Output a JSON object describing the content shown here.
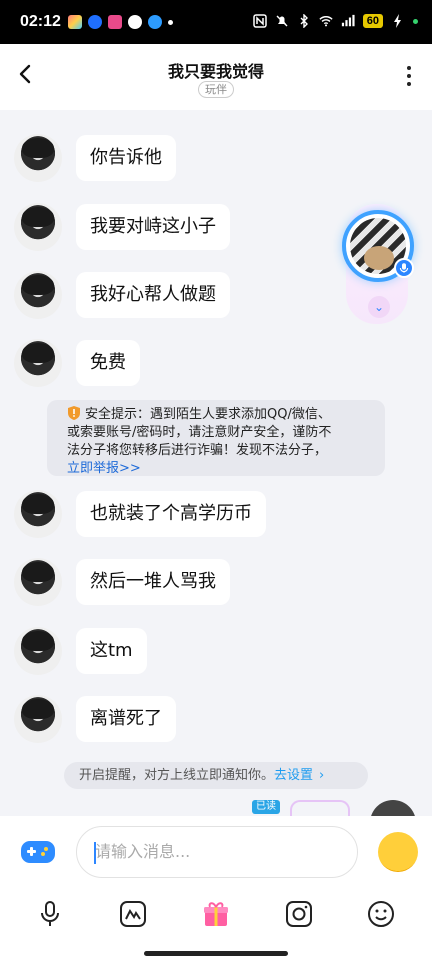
{
  "status_bar": {
    "time": "02:12",
    "battery": "60",
    "network": "5G"
  },
  "header": {
    "title": "我只要我觉得",
    "tag": "玩伴"
  },
  "messages": [
    {
      "text": "你告诉他"
    },
    {
      "text": "我要对峙这小子"
    },
    {
      "text": "我好心帮人做题"
    },
    {
      "text": "免费"
    },
    {
      "text": "也就装了个高学历币"
    },
    {
      "text": "然后一堆人骂我"
    },
    {
      "text": "这tm"
    },
    {
      "text": "离谱死了"
    }
  ],
  "safety_notice": {
    "line1": "安全提示：遇到陌生人要求添加QQ/微信、",
    "line2": "或索要账号/密码时，请注意财产安全，谨防不",
    "line3": "法分子将您转移后进行诈骗！发现不法分子，",
    "link": "立即举报>>"
  },
  "online_reminder": {
    "text": "开启提醒，对方上线立即通知你。",
    "action": "去设置",
    "chevron": "›"
  },
  "read_tag": "已读",
  "input": {
    "placeholder": "请输入消息..."
  },
  "colors": {
    "accent": "#2d86ff",
    "link": "#1e6ad8",
    "chat_bg": "#f3f4f8"
  },
  "icons": [
    "back-arrow-icon",
    "more-vertical-icon",
    "microphone-icon",
    "game-controller-icon",
    "emoji-icon",
    "voice-input-icon",
    "doodle-icon",
    "gift-icon",
    "camera-icon",
    "sticker-icon"
  ]
}
